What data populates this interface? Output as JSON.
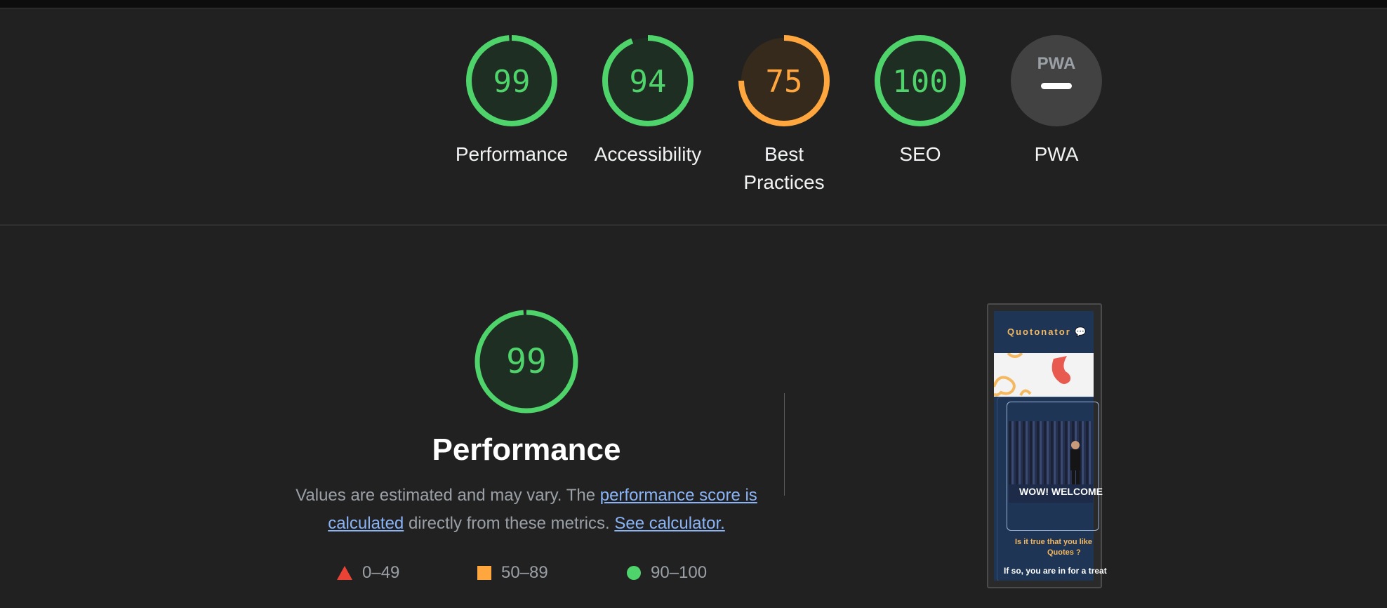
{
  "categories": [
    {
      "score": "99",
      "label": "Performance",
      "value": 0.99,
      "color": "#4fd46b"
    },
    {
      "score": "94",
      "label": "Accessibility",
      "value": 0.94,
      "color": "#4fd46b"
    },
    {
      "score": "75",
      "label": "Best Practices",
      "value": 0.75,
      "color": "#ffa63f"
    },
    {
      "score": "100",
      "label": "SEO",
      "value": 1.0,
      "color": "#4fd46b"
    },
    {
      "score": "PWA",
      "label": "PWA",
      "value": 0,
      "color": "#9aa0a6"
    }
  ],
  "performance": {
    "score": "99",
    "value": 0.99,
    "title": "Performance",
    "desc_prefix": "Values are estimated and may vary. The ",
    "link_score": "performance score is calculated",
    "desc_middle": " directly from these metrics. ",
    "link_calc": "See calculator."
  },
  "legend": {
    "fail": "0–49",
    "average": "50–89",
    "pass": "90–100"
  },
  "colors": {
    "pass": "#4fd46b",
    "average": "#ffa63f",
    "fail": "#ea4335",
    "link": "#8ab4f8"
  },
  "thumbnail": {
    "brand": "Quotonator 💬",
    "welcome": "WOW! WELCOME",
    "question_line1": "Is it true that you like",
    "question_line2": "Quotes ?",
    "line2": "If so, you are in for a treat"
  }
}
